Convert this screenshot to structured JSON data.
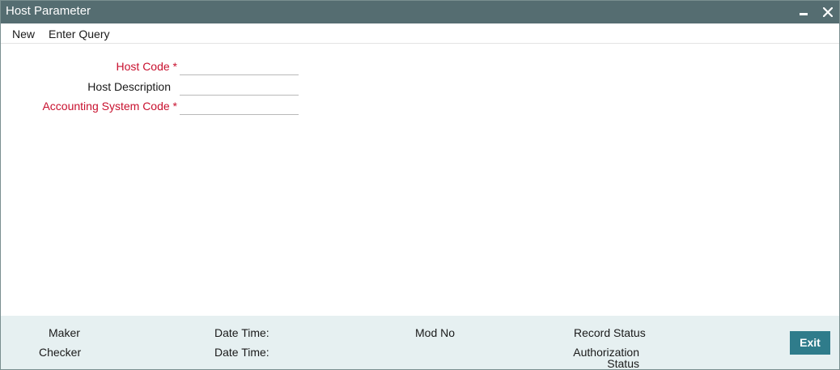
{
  "window": {
    "title": "Host Parameter",
    "controls": {
      "minimize_icon": "minimize-icon",
      "close_icon": "close-icon"
    }
  },
  "menu": {
    "new_label": "New",
    "enter_query_label": "Enter Query"
  },
  "form": {
    "host_code": {
      "label": "Host Code *",
      "value": "",
      "required": true
    },
    "host_description": {
      "label": "Host Description",
      "value": "",
      "required": false
    },
    "accounting_system_code": {
      "label": "Accounting System Code *",
      "value": "",
      "required": true
    }
  },
  "footer": {
    "maker_label": "Maker",
    "checker_label": "Checker",
    "maker_datetime_label": "Date Time:",
    "checker_datetime_label": "Date Time:",
    "mod_no_label": "Mod No",
    "record_status_label": "Record Status",
    "authorization_status_label": "Authorization Status",
    "exit_label": "Exit"
  },
  "colors": {
    "titlebar": "#556d71",
    "required_label": "#c8102e",
    "footer_bg": "#e6f0f1",
    "exit_button": "#2f7c8b"
  }
}
